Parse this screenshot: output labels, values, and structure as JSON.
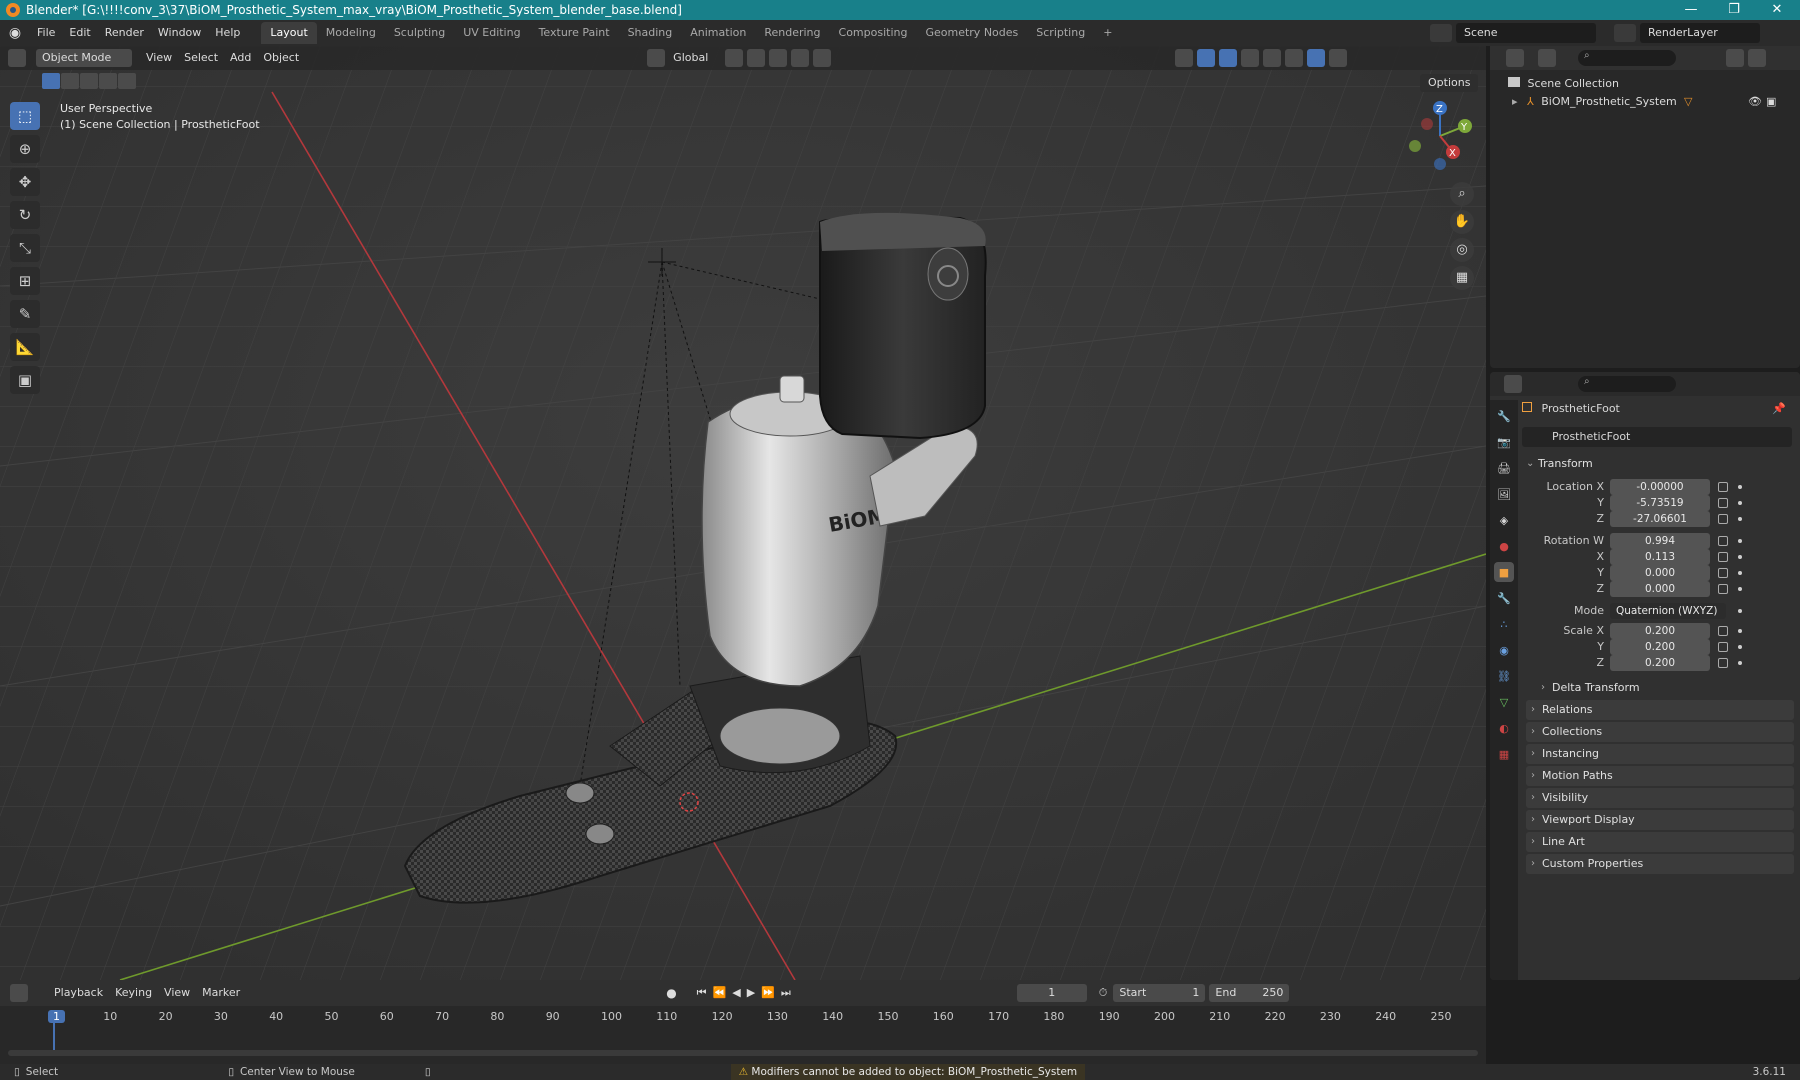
{
  "window": {
    "title": "Blender* [G:\\!!!!conv_3\\37\\BiOM_Prosthetic_System_max_vray\\BiOM_Prosthetic_System_blender_base.blend]",
    "minimize": "—",
    "maximize": "❐",
    "close": "✕"
  },
  "menu": [
    "File",
    "Edit",
    "Render",
    "Window",
    "Help"
  ],
  "workspaces": [
    "Layout",
    "Modeling",
    "Sculpting",
    "UV Editing",
    "Texture Paint",
    "Shading",
    "Animation",
    "Rendering",
    "Compositing",
    "Geometry Nodes",
    "Scripting"
  ],
  "workspace_add": "+",
  "scene_name": "Scene",
  "view_layer": "RenderLayer",
  "viewport": {
    "mode": "Object Mode",
    "header_menu": [
      "View",
      "Select",
      "Add",
      "Object"
    ],
    "orientation": "Global",
    "options_label": "Options",
    "info_line1": "User Perspective",
    "info_line2": "(1) Scene Collection | ProstheticFoot",
    "gizmo_axes": {
      "x": "X",
      "y": "Y",
      "z": "Z"
    },
    "logo_text": "BiOM"
  },
  "outliner": {
    "root": "Scene Collection",
    "items": [
      {
        "label": "BiOM_Prosthetic_System"
      }
    ]
  },
  "properties": {
    "object_name": "ProstheticFoot",
    "data_name": "ProstheticFoot",
    "section_title": "Transform",
    "location": {
      "label_x": "Location X",
      "label_y": "Y",
      "label_z": "Z",
      "x": "-0.00000",
      "y": "-5.73519",
      "z": "-27.06601"
    },
    "rotation": {
      "label_w": "Rotation W",
      "label_x": "X",
      "label_y": "Y",
      "label_z": "Z",
      "w": "0.994",
      "x": "0.113",
      "y": "0.000",
      "z": "0.000"
    },
    "mode_label": "Mode",
    "mode_value": "Quaternion (WXYZ)",
    "scale": {
      "label_x": "Scale X",
      "label_y": "Y",
      "label_z": "Z",
      "x": "0.200",
      "y": "0.200",
      "z": "0.200"
    },
    "delta_transform": "Delta Transform",
    "collapsed_panels": [
      "Relations",
      "Collections",
      "Instancing",
      "Motion Paths",
      "Visibility",
      "Viewport Display",
      "Line Art",
      "Custom Properties"
    ]
  },
  "timeline": {
    "menus": [
      "Playback",
      "Keying",
      "View",
      "Marker"
    ],
    "current_frame": "1",
    "start_label": "Start",
    "start": "1",
    "end_label": "End",
    "end": "250",
    "ruler": [
      "1",
      "10",
      "20",
      "30",
      "40",
      "50",
      "60",
      "70",
      "80",
      "90",
      "100",
      "110",
      "120",
      "130",
      "140",
      "150",
      "160",
      "170",
      "180",
      "190",
      "200",
      "210",
      "220",
      "230",
      "240",
      "250"
    ]
  },
  "status": {
    "left": "Select",
    "middle": "Center View to Mouse",
    "warning": "Modifiers cannot be added to object: BiOM_Prosthetic_System",
    "version": "3.6.11"
  },
  "colors": {
    "titlebar": "#18808a",
    "accent": "#4772b3",
    "x_axis": "#c43c3c",
    "y_axis": "#7ea83a",
    "z_axis": "#3a73c4"
  }
}
